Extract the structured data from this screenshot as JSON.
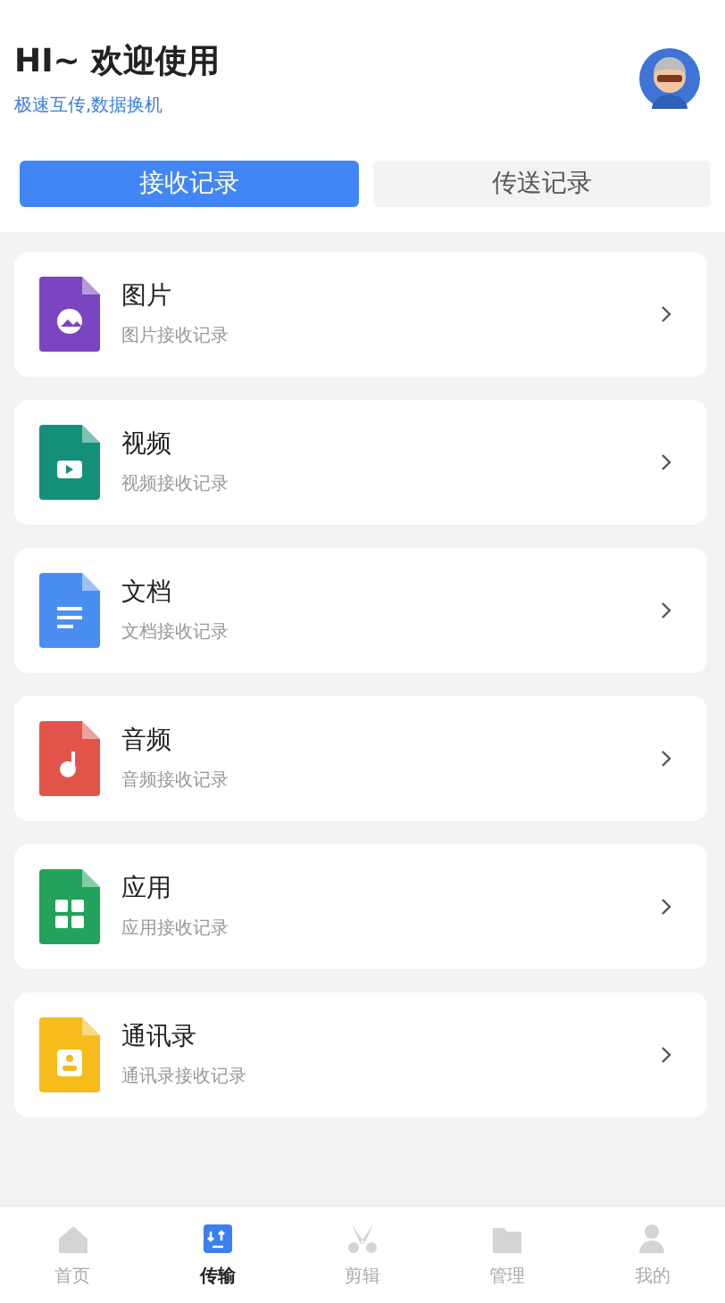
{
  "header": {
    "title": "HI~ 欢迎使用",
    "subtitle": "极速互传,数据换机"
  },
  "tabs": [
    {
      "label": "接收记录",
      "selected": true
    },
    {
      "label": "传送记录",
      "selected": false
    }
  ],
  "records": [
    {
      "kind": "image",
      "color": "#7b44c0",
      "title": "图片",
      "subtitle": "图片接收记录"
    },
    {
      "kind": "video",
      "color": "#148f7a",
      "title": "视频",
      "subtitle": "视频接收记录"
    },
    {
      "kind": "document",
      "color": "#4b8ef2",
      "title": "文档",
      "subtitle": "文档接收记录"
    },
    {
      "kind": "audio",
      "color": "#e2544a",
      "title": "音频",
      "subtitle": "音频接收记录"
    },
    {
      "kind": "app",
      "color": "#22a25a",
      "title": "应用",
      "subtitle": "应用接收记录"
    },
    {
      "kind": "contact",
      "color": "#f5bc1c",
      "title": "通讯录",
      "subtitle": "通讯录接收记录"
    }
  ],
  "nav": [
    {
      "kind": "home",
      "label": "首页",
      "selected": false
    },
    {
      "kind": "transfer",
      "label": "传输",
      "selected": true
    },
    {
      "kind": "edit",
      "label": "剪辑",
      "selected": false
    },
    {
      "kind": "folder",
      "label": "管理",
      "selected": false
    },
    {
      "kind": "user",
      "label": "我的",
      "selected": false
    }
  ]
}
